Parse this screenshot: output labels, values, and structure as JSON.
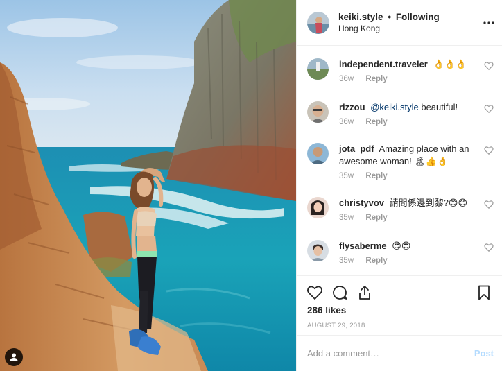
{
  "post": {
    "username": "keiki.style",
    "follow_status": "Following",
    "separator": "•",
    "location": "Hong Kong",
    "more_icon": "more-options-icon",
    "tag_icon": "user-tag-icon"
  },
  "comments": [
    {
      "user": "independent.traveler",
      "text": "👌👌👌",
      "mention": "",
      "time": "36w",
      "reply": "Reply"
    },
    {
      "user": "rizzou",
      "mention": "@keiki.style",
      "text": " beautiful!",
      "time": "36w",
      "reply": "Reply"
    },
    {
      "user": "jota_pdf",
      "mention": "",
      "text": "Amazing place with an awesome woman! 🏝👍👌",
      "time": "35w",
      "reply": "Reply"
    },
    {
      "user": "christyvov",
      "mention": "",
      "text": "請問係邊到黎?😊😊",
      "time": "35w",
      "reply": "Reply"
    },
    {
      "user": "flysaberme",
      "mention": "",
      "text": "😍😍",
      "time": "35w",
      "reply": "Reply"
    }
  ],
  "actions": {
    "like_icon": "heart-icon",
    "comment_icon": "comment-bubble-icon",
    "share_icon": "share-icon",
    "save_icon": "bookmark-icon"
  },
  "likes_text": "286 likes",
  "date_text": "AUGUST 29, 2018",
  "add_comment": {
    "placeholder": "Add a comment…",
    "value": "",
    "post_label": "Post"
  },
  "colors": {
    "link": "#003569",
    "muted": "#999999",
    "post_disabled": "#b3dbff",
    "divider": "#efefef"
  }
}
